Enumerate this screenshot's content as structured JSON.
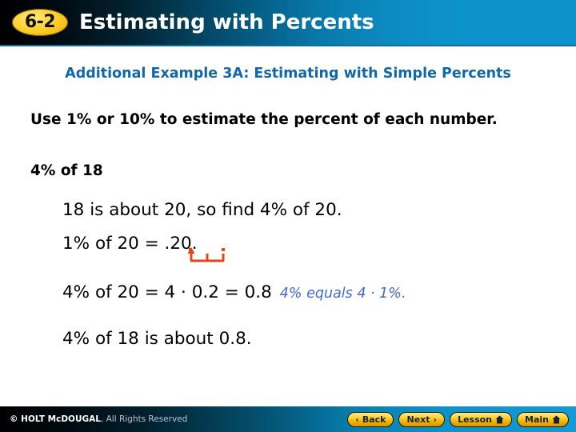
{
  "header": {
    "badge": "6-2",
    "title": "Estimating with Percents",
    "accent_blue": "#0e92cb"
  },
  "slide": {
    "subtitle": "Additional Example 3A: Estimating with Simple Percents",
    "instruction": "Use 1% or 10% to estimate the percent of each number.",
    "problem": "4% of 18",
    "steps": [
      {
        "text": "18 is about 20, so find 4% of 20."
      },
      {
        "text": "1% of 20 = .20."
      },
      {
        "text": "4% of 20 = 4 · 0.2 = 0.8",
        "note": "4% equals 4 · 1%."
      },
      {
        "text": "4% of 18 is about 0.8."
      }
    ],
    "annotation": {
      "name": "decimal-shift-marks",
      "color": "#e8441a",
      "hops": 2,
      "direction": "left"
    },
    "note_color": "#4169d0",
    "subtitle_color": "#1167a8"
  },
  "footer": {
    "copyright_bold": "© HOLT McDOUGAL",
    "copyright_rest": ", All Rights Reserved",
    "buttons": [
      {
        "label": "Back",
        "icon": "chevron-left-icon",
        "glyph": "‹"
      },
      {
        "label": "Next",
        "icon": "chevron-right-icon",
        "glyph": "›"
      },
      {
        "label": "Lesson",
        "icon": "home-icon",
        "glyph": ""
      },
      {
        "label": "Main",
        "icon": "home-icon",
        "glyph": ""
      }
    ]
  }
}
